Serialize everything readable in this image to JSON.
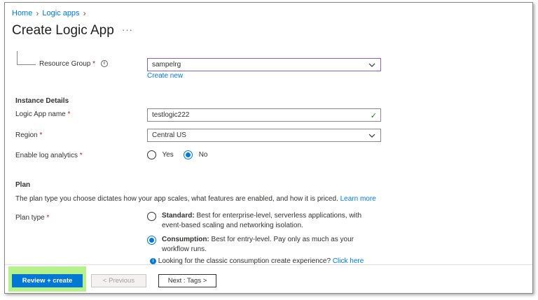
{
  "breadcrumb": [
    {
      "label": "Home"
    },
    {
      "label": "Logic apps"
    }
  ],
  "page_title": "Create Logic App",
  "header_more": "···",
  "resource_group": {
    "label": "Resource Group",
    "value": "sampelrg",
    "create_new": "Create new"
  },
  "instance_details": {
    "title": "Instance Details",
    "app_name_label": "Logic App name",
    "app_name_value": "testlogic222",
    "region_label": "Region",
    "region_value": "Central US",
    "log_analytics_label": "Enable log analytics",
    "log_analytics_options": [
      "Yes",
      "No"
    ],
    "log_analytics_selected": "No"
  },
  "plan": {
    "title": "Plan",
    "description": "The plan type you choose dictates how your app scales, what features are enabled, and how it is priced.",
    "learn_more": "Learn more",
    "type_label": "Plan type",
    "options": [
      {
        "name": "Standard:",
        "desc": " Best for enterprise-level, serverless applications, with event-based scaling and networking isolation.",
        "selected": false
      },
      {
        "name": "Consumption:",
        "desc": " Best for entry-level. Pay only as much as your workflow runs.",
        "selected": true
      }
    ],
    "classic_note": "Looking for the classic consumption create experience?",
    "classic_link": "Click here"
  },
  "footer": {
    "review_create": "Review + create",
    "previous": "< Previous",
    "next": "Next : Tags >"
  },
  "required_marker": "*",
  "colors": {
    "accent": "#0078d4",
    "required": "#a4262c",
    "valid": "#107c10",
    "focus_border": "#8764b8",
    "highlight": "#b6f28a"
  }
}
